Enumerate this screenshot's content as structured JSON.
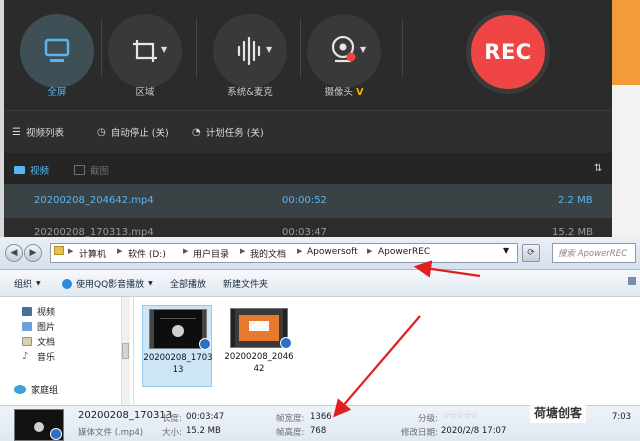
{
  "apowerrec": {
    "tools": [
      {
        "label": "全屏",
        "icon": "monitor-icon"
      },
      {
        "label": "区域",
        "icon": "crop-icon"
      },
      {
        "label": "系统&麦克",
        "icon": "audio-wave-icon"
      },
      {
        "label": "摄像头",
        "icon": "webcam-icon"
      }
    ],
    "rec_label": "REC",
    "toolbar": {
      "video_list": "视频列表",
      "auto_stop": "自动停止 (关)",
      "scheduled": "计划任务 (关)"
    },
    "tabs": {
      "video": "视频",
      "screenshot": "截图"
    },
    "files": [
      {
        "name": "20200208_204642.mp4",
        "duration": "00:00:52",
        "size": "2.2 MB"
      },
      {
        "name": "20200208_170313.mp4",
        "duration": "00:03:47",
        "size": "15.2 MB"
      }
    ],
    "colors": {
      "accent": "#5ab6ee",
      "rec": "#ef4545"
    }
  },
  "explorer": {
    "breadcrumbs": [
      "计算机",
      "软件 (D:)",
      "用户目录",
      "我的文档",
      "Apowersoft",
      "ApowerREC"
    ],
    "search_placeholder": "搜索 ApowerREC",
    "commands": {
      "organize": "组织",
      "play_with": "使用QQ影音播放",
      "play_all": "全部播放",
      "new_folder": "新建文件夹"
    },
    "nav": [
      "视频",
      "图片",
      "文档",
      "音乐",
      "家庭组"
    ],
    "items": [
      {
        "caption": "20200208_170313"
      },
      {
        "caption": "20200208_204642"
      }
    ],
    "details": {
      "filename": "20200208_170313",
      "filetype": "媒体文件 (.mp4)",
      "length_label": "长度:",
      "length": "00:03:47",
      "size_label": "大小:",
      "size": "15.2 MB",
      "width_label": "帧宽度:",
      "width": "1366",
      "height_label": "帧高度:",
      "height": "768",
      "rating_label": "分级:",
      "stars": "☆☆☆☆☆",
      "modified_label": "修改日期:",
      "modified": "2020/2/8 17:07",
      "corner_time": "7:03"
    }
  },
  "watermark": "荷塘创客"
}
